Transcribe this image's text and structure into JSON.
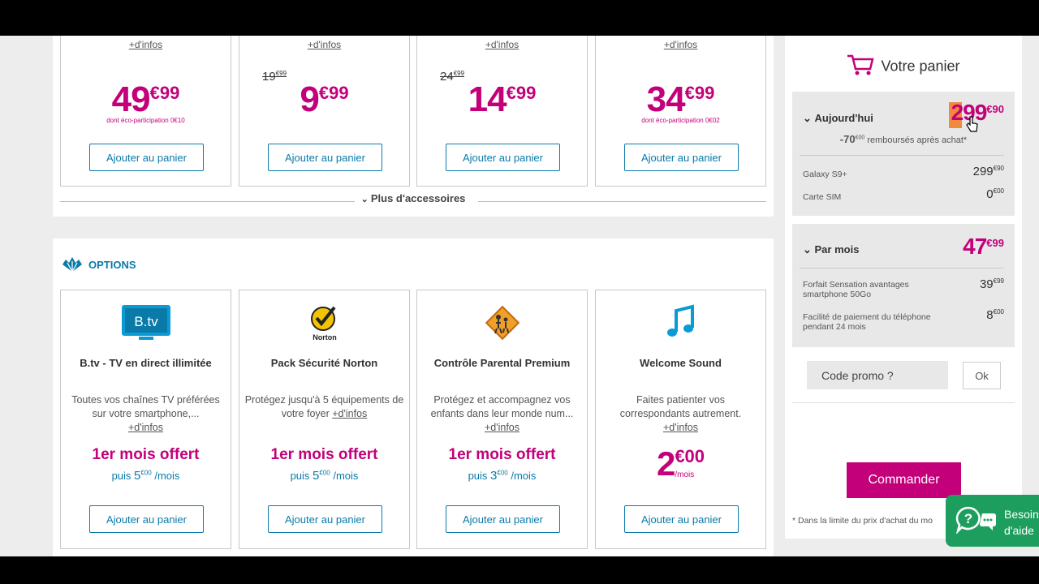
{
  "accessories": {
    "cards": [
      {
        "infos": "+d'infos",
        "old_price": "",
        "old_cents": "",
        "price": "49",
        "cents": "€99",
        "eco": "dont éco-participation 0€10",
        "button": "Ajouter au panier"
      },
      {
        "infos": "+d'infos",
        "old_price": "19",
        "old_cents": "€99",
        "price": "9",
        "cents": "€99",
        "eco": "",
        "button": "Ajouter au panier"
      },
      {
        "infos": "+d'infos",
        "old_price": "24",
        "old_cents": "€99",
        "price": "14",
        "cents": "€99",
        "eco": "",
        "button": "Ajouter au panier"
      },
      {
        "infos": "+d'infos",
        "old_price": "",
        "old_cents": "",
        "price": "34",
        "cents": "€99",
        "eco": "dont éco-participation 0€02",
        "button": "Ajouter au panier"
      }
    ],
    "more_label": "Plus d'accessoires"
  },
  "options": {
    "heading": "OPTIONS",
    "cards": [
      {
        "icon": "btv-icon",
        "title": "B.tv - TV en direct illimitée",
        "desc": "Toutes vos chaînes TV préférées sur votre smartphone,...",
        "infos": "+d'infos",
        "offer": "1er mois offert",
        "after_prefix": "puis ",
        "after_price": "5",
        "after_cents": "€00",
        "after_suffix": " /mois",
        "button": "Ajouter au panier"
      },
      {
        "icon": "norton-icon",
        "title": "Pack Sécurité Norton",
        "desc": "Protégez jusqu'à 5 équipements de votre foyer",
        "infos": "+d'infos",
        "offer": "1er mois offert",
        "after_prefix": "puis ",
        "after_price": "5",
        "after_cents": "€00",
        "after_suffix": " /mois",
        "button": "Ajouter au panier"
      },
      {
        "icon": "parental-icon",
        "title": "Contrôle Parental Premium",
        "desc": "Protégez et accompagnez vos enfants dans leur monde num...",
        "infos": "+d'infos",
        "offer": "1er mois offert",
        "after_prefix": "puis ",
        "after_price": "3",
        "after_cents": "€00",
        "after_suffix": " /mois",
        "button": "Ajouter au panier"
      },
      {
        "icon": "music-note-icon",
        "title": "Welcome Sound",
        "desc": "Faites patienter vos correspondants autrement.",
        "infos": "+d'infos",
        "price": "2",
        "cents": "€00",
        "per": "/mois",
        "button": "Ajouter au panier"
      }
    ]
  },
  "cart": {
    "title": "Votre panier",
    "today": {
      "label": "Aujourd'hui",
      "price": "299",
      "cents": "€90",
      "refund_value": "-70",
      "refund_cents": "€00",
      "refund_text": " remboursés après achat*",
      "rows": [
        {
          "label": "Galaxy S9+",
          "value": "299",
          "cents": "€90"
        },
        {
          "label": "Carte SIM",
          "value": "0",
          "cents": "€00"
        }
      ]
    },
    "monthly": {
      "label": "Par mois",
      "price": "47",
      "cents": "€99",
      "rows": [
        {
          "label": "Forfait Sensation avantages smartphone 50Go",
          "value": "39",
          "cents": "€99"
        },
        {
          "label": "Facilité de paiement du téléphone pendant 24 mois",
          "value": "8",
          "cents": "€00"
        }
      ]
    },
    "promo_placeholder": "Code promo ?",
    "ok_label": "Ok",
    "order_label": "Commander",
    "note": "* Dans la limite du prix d'achat du mo"
  },
  "help": {
    "line1": "Besoin",
    "line2": "d'aide"
  },
  "colors": {
    "brand": "#c3007a",
    "link": "#0a7aa8",
    "help": "#1e9e5e"
  }
}
